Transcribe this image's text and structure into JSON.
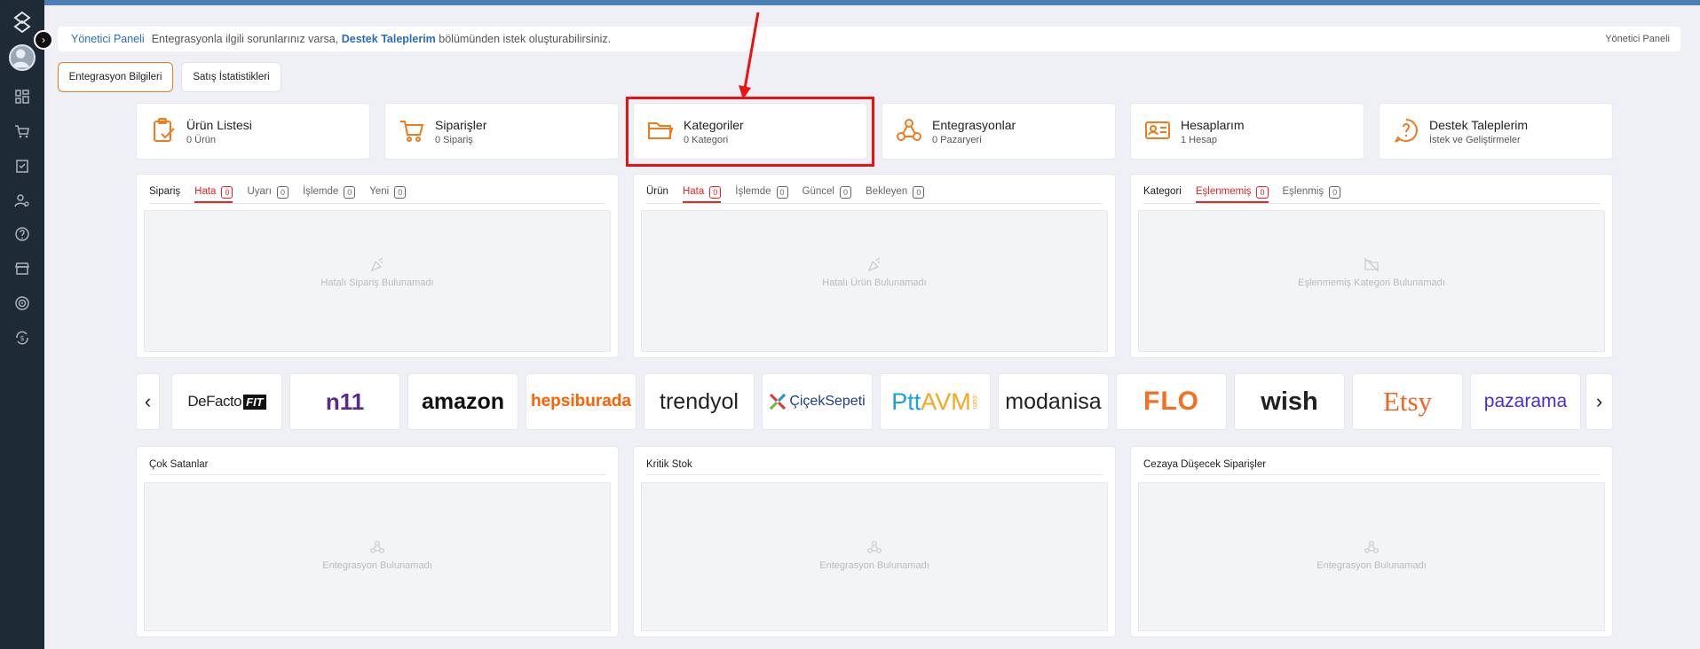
{
  "breadcrumb": {
    "home": "Yönetici Paneli",
    "message_before": "Entegrasyonla ilgili sorunlarınız varsa,",
    "message_link": "Destek Taleplerim",
    "message_after": "bölümünden istek oluşturabilirsiniz.",
    "right_label": "Yönetici Paneli"
  },
  "tabs": [
    {
      "label": "Entegrasyon Bilgileri",
      "active": true
    },
    {
      "label": "Satış İstatistikleri",
      "active": false
    }
  ],
  "cards": [
    {
      "title": "Ürün Listesi",
      "subtitle": "0 Ürün",
      "icon": "clipboard-check-icon"
    },
    {
      "title": "Siparişler",
      "subtitle": "0 Sipariş",
      "icon": "cart-icon"
    },
    {
      "title": "Kategoriler",
      "subtitle": "0 Kategori",
      "icon": "folder-icon"
    },
    {
      "title": "Entegrasyonlar",
      "subtitle": "0 Pazaryeri",
      "icon": "webhook-icon"
    },
    {
      "title": "Hesaplarım",
      "subtitle": "1 Hesap",
      "icon": "id-card-icon"
    },
    {
      "title": "Destek Taleplerim",
      "subtitle": "İstek ve Geliştirmeler",
      "icon": "help-circle-icon"
    }
  ],
  "panels": [
    {
      "title": "Sipariş",
      "tabs": [
        {
          "label": "Hata",
          "count": "0"
        },
        {
          "label": "Uyarı",
          "count": "0"
        },
        {
          "label": "İşlemde",
          "count": "0"
        },
        {
          "label": "Yeni",
          "count": "0"
        }
      ],
      "empty": "Hatalı Sipariş Bulunamadı"
    },
    {
      "title": "Ürün",
      "tabs": [
        {
          "label": "Hata",
          "count": "0"
        },
        {
          "label": "İşlemde",
          "count": "0"
        },
        {
          "label": "Güncel",
          "count": "0"
        },
        {
          "label": "Bekleyen",
          "count": "0"
        }
      ],
      "empty": "Hatalı Ürün Bulunamadı"
    },
    {
      "title": "Kategori",
      "tabs": [
        {
          "label": "Eşlenmemiş",
          "count": "0"
        },
        {
          "label": "Eşlenmiş",
          "count": "0"
        }
      ],
      "empty": "Eşlenmemiş Kategori Bulunamadı"
    }
  ],
  "marketplaces": [
    "DeFacto",
    "FIT",
    "n11",
    "amazon",
    "hepsiburada",
    "trendyol",
    "ÇiçekSepeti",
    "Ptt",
    "AVM",
    ".com",
    "modanisa",
    "FLO",
    "wish",
    "Etsy",
    "pazarama"
  ],
  "bottom_panels": [
    {
      "title": "Çok Satanlar",
      "empty": "Entegrasyon Bulunamadı"
    },
    {
      "title": "Kritik Stok",
      "empty": "Entegrasyon Bulunamadı"
    },
    {
      "title": "Cezaya Düşecek Siparişler",
      "empty": "Entegrasyon Bulunamadı"
    }
  ],
  "colors": {
    "accent": "#f07b1d",
    "link": "#2a6ebd",
    "error": "#e22",
    "sidebar": "#1f2a37",
    "highlight": "#e11"
  }
}
